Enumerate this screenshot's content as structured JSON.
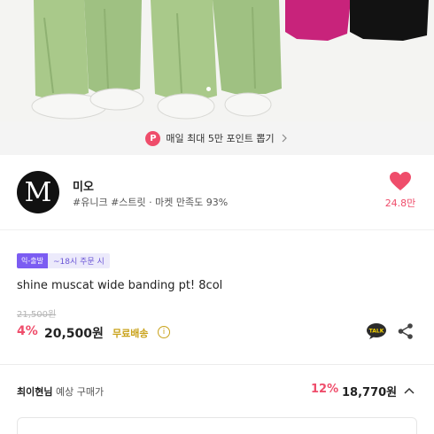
{
  "points_banner": {
    "badge": "P",
    "text": "매일 최대 5만 포인트 뽑기"
  },
  "seller": {
    "logo_letter": "M",
    "name": "미오",
    "tags": "#유니크 #스트릿 · 마켓 만족도 93%",
    "like_count": "24.8만"
  },
  "product": {
    "delivery_tag": "익-출발",
    "delivery_note": "~18시 주문 시",
    "title": "shine muscat wide banding pt! 8col",
    "original_price": "21,500원",
    "discount": "4%",
    "price": "20,500원",
    "shipping": "무료배송",
    "info_glyph": "i"
  },
  "expected": {
    "buyer_name": "최이현님",
    "buyer_label": " 예상 구매가",
    "discount": "12%",
    "price": "18,770원"
  },
  "colors": {
    "accent": "#ef4d6b",
    "shipping": "#c9a21a",
    "delivery": "#7b5cf2"
  },
  "icons": [
    "points-badge-icon",
    "chevron-right-icon",
    "heart-icon",
    "info-icon",
    "kakao-talk-icon",
    "share-icon",
    "chevron-up-icon"
  ]
}
